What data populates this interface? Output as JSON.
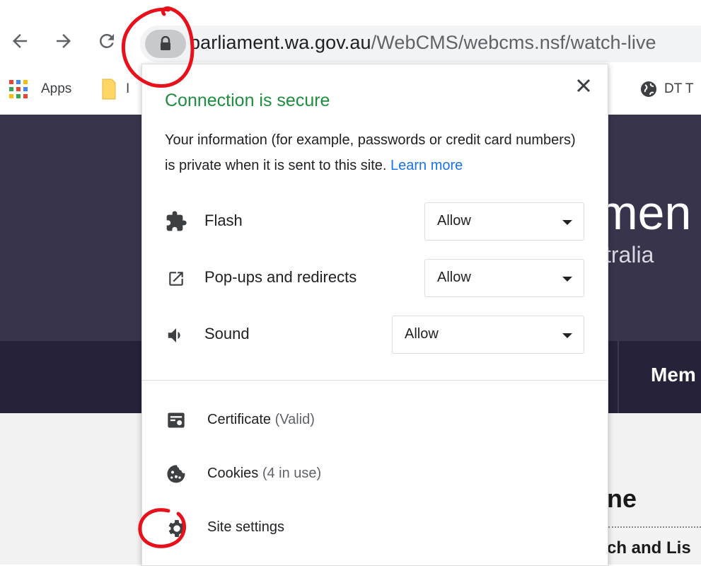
{
  "browser": {
    "url_host": "parliament.wa.gov.au",
    "url_path": "/WebCMS/webcms.nsf/watch-live",
    "bookmarks": [
      {
        "label": "Apps",
        "icon": "apps-grid-icon"
      },
      {
        "label": "I",
        "icon": "folder-icon"
      },
      {
        "label": "DT T",
        "icon": "globe-icon"
      }
    ]
  },
  "site": {
    "title_fragment": "men",
    "subtitle_fragment": "tralia",
    "nav_item_fragment": "Mem",
    "heading_fragment": "ne",
    "sublink_fragment": "ch and Lis"
  },
  "popup": {
    "title": "Connection is secure",
    "info_text": "Your information (for example, passwords or credit card numbers) is private when it is sent to this site.",
    "learn_more": "Learn more",
    "permissions": [
      {
        "label": "Flash",
        "value": "Allow",
        "icon": "puzzle-piece-icon"
      },
      {
        "label": "Pop-ups and redirects",
        "value": "Allow",
        "icon": "open-external-icon"
      },
      {
        "label": "Sound",
        "value": "Allow",
        "icon": "speaker-icon"
      }
    ],
    "items": [
      {
        "label": "Certificate",
        "note": "(Valid)",
        "icon": "certificate-icon"
      },
      {
        "label": "Cookies",
        "note": "(4 in use)",
        "icon": "cookie-icon"
      },
      {
        "label": "Site settings",
        "note": "",
        "icon": "gear-icon"
      }
    ]
  },
  "colors": {
    "secure_green": "#1e8e3e",
    "link_blue": "#1a73e8",
    "site_header": "#38344c",
    "site_nav": "#25223a",
    "annotation_red": "#e8101a"
  }
}
